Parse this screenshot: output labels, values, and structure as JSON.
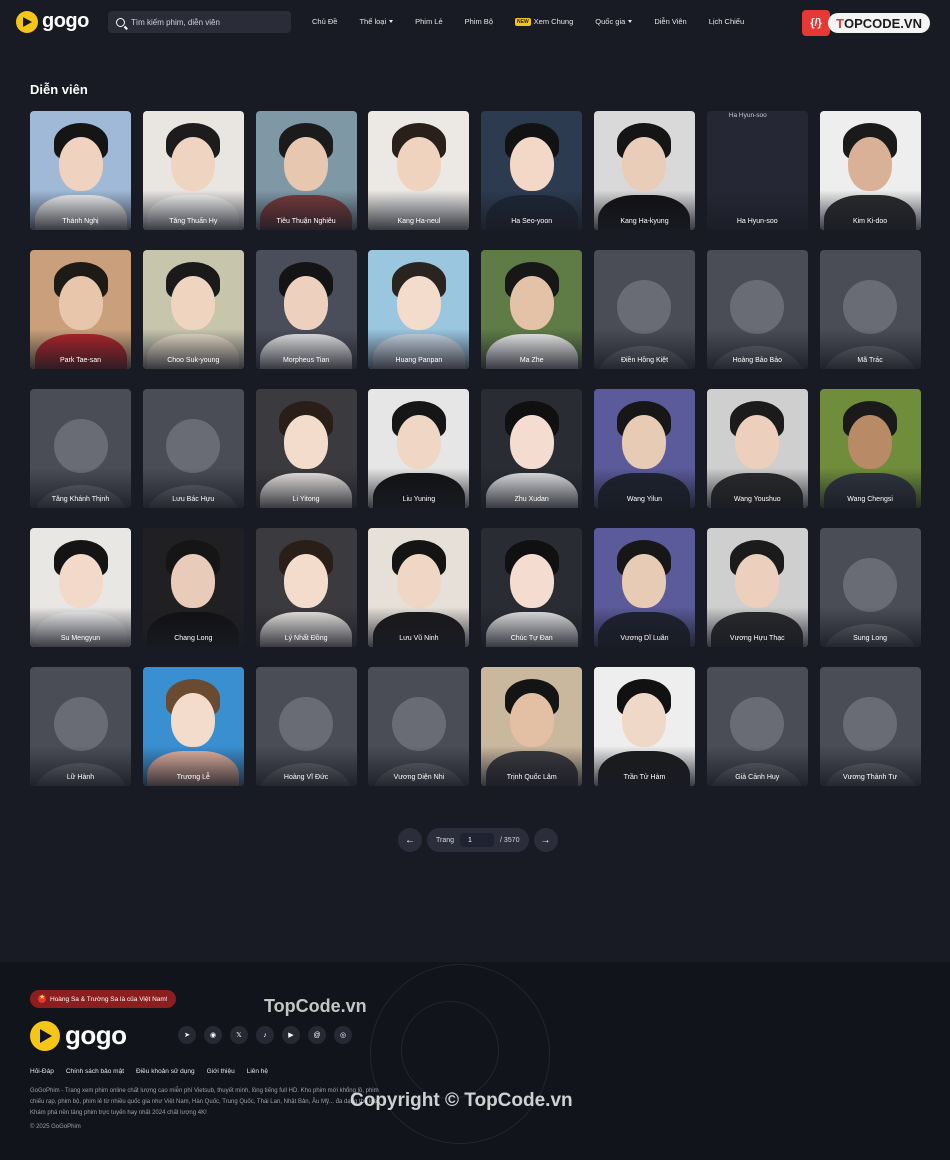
{
  "header": {
    "logo": "gogo",
    "search_placeholder": "Tìm kiếm phim, diễn viên",
    "nav": [
      {
        "label": "Chủ Đề",
        "dropdown": false,
        "badge": ""
      },
      {
        "label": "Thể loại",
        "dropdown": true,
        "badge": ""
      },
      {
        "label": "Phim Lẻ",
        "dropdown": false,
        "badge": ""
      },
      {
        "label": "Phim Bộ",
        "dropdown": false,
        "badge": ""
      },
      {
        "label": "Xem Chung",
        "dropdown": false,
        "badge": "NEW"
      },
      {
        "label": "Quốc gia",
        "dropdown": true,
        "badge": ""
      },
      {
        "label": "Diễn Viên",
        "dropdown": false,
        "badge": ""
      },
      {
        "label": "Lịch Chiếu",
        "dropdown": false,
        "badge": ""
      }
    ],
    "brand_icon": "{/}",
    "brand_text_a": "T",
    "brand_text_b": "OPCODE.VN"
  },
  "page_title": "Diễn viên",
  "actors": [
    {
      "name": "Thành Nghị",
      "kind": "photo",
      "bg": "#9fb9d6",
      "skin": "#efd2bf",
      "hair": "#151515",
      "cloth": "#f2f2f2"
    },
    {
      "name": "Tăng Thuấn Hy",
      "kind": "photo",
      "bg": "#e9e6e2",
      "skin": "#efd4c1",
      "hair": "#1c1c1c",
      "cloth": "#f5f5f5"
    },
    {
      "name": "Tiêu Thuận Nghiêu",
      "kind": "photo",
      "bg": "#7f98a6",
      "skin": "#e8c7b0",
      "hair": "#1b1b1b",
      "cloth": "#7a3b3b"
    },
    {
      "name": "Kang Ha-neul",
      "kind": "photo",
      "bg": "#ece9e4",
      "skin": "#f0d3be",
      "hair": "#2a201a",
      "cloth": "#e7e7e7"
    },
    {
      "name": "Ha Seo-yoon",
      "kind": "photo",
      "bg": "#2c3b50",
      "skin": "#f3d8c8",
      "hair": "#121212",
      "cloth": "#1c2636"
    },
    {
      "name": "Kang Ha-kyung",
      "kind": "photo",
      "bg": "#d9d9d9",
      "skin": "#e9cdb9",
      "hair": "#151515",
      "cloth": "#111111"
    },
    {
      "name": "Ha Hyun-soo",
      "kind": "broken",
      "alt": "Ha Hyun-soo"
    },
    {
      "name": "Kim Ki-doo",
      "kind": "photo",
      "bg": "#eeeeee",
      "skin": "#d9b196",
      "hair": "#1a1a1a",
      "cloth": "#2b2b2b"
    },
    {
      "name": "Park Tae-san",
      "kind": "photo",
      "bg": "#c9a07b",
      "skin": "#e7c6ac",
      "hair": "#1e1a16",
      "cloth": "#b3242a"
    },
    {
      "name": "Choo Suk-young",
      "kind": "photo",
      "bg": "#c8c5ad",
      "skin": "#efd4c0",
      "hair": "#1a1a1a",
      "cloth": "#e6dcc7"
    },
    {
      "name": "Morpheus Tian",
      "kind": "photo",
      "bg": "#4a4e5a",
      "skin": "#edd0bd",
      "hair": "#141414",
      "cloth": "#e7e7e7"
    },
    {
      "name": "Huang Panpan",
      "kind": "photo",
      "bg": "#9ac6e0",
      "skin": "#f3dccc",
      "hair": "#2a2420",
      "cloth": "#c8d6e3"
    },
    {
      "name": "Ma Zhe",
      "kind": "photo",
      "bg": "#5f7b46",
      "skin": "#e3c2a8",
      "hair": "#171717",
      "cloth": "#efefef"
    },
    {
      "name": "Điền Hồng Kiệt",
      "kind": "placeholder"
    },
    {
      "name": "Hoàng Bảo Bảo",
      "kind": "placeholder"
    },
    {
      "name": "Mã Trác",
      "kind": "placeholder"
    },
    {
      "name": "Tăng Khánh Thịnh",
      "kind": "placeholder"
    },
    {
      "name": "Lưu Bác Hựu",
      "kind": "placeholder"
    },
    {
      "name": "Li Yitong",
      "kind": "photo",
      "bg": "#3b3a3e",
      "skin": "#f4dccd",
      "hair": "#2a1e18",
      "cloth": "#f0ece7"
    },
    {
      "name": "Liu Yuning",
      "kind": "photo",
      "bg": "#e6e6e6",
      "skin": "#f0d6c4",
      "hair": "#161616",
      "cloth": "#121212"
    },
    {
      "name": "Zhu Xudan",
      "kind": "photo",
      "bg": "#2a2c34",
      "skin": "#f4ddd0",
      "hair": "#101010",
      "cloth": "#e8e8ea"
    },
    {
      "name": "Wang Yilun",
      "kind": "photo",
      "bg": "#5b5a9a",
      "skin": "#e8cbb5",
      "hair": "#171717",
      "cloth": "#1d2330"
    },
    {
      "name": "Wang Youshuo",
      "kind": "photo",
      "bg": "#cfcfcf",
      "skin": "#ecd0bd",
      "hair": "#1b1b1b",
      "cloth": "#2a2a2a"
    },
    {
      "name": "Wang Chengsi",
      "kind": "photo",
      "bg": "#6f8d3a",
      "skin": "#b98a66",
      "hair": "#1a1a1a",
      "cloth": "#2f3640"
    },
    {
      "name": "Su Mengyun",
      "kind": "photo",
      "bg": "#e9e7e4",
      "skin": "#f2d9c9",
      "hair": "#141414",
      "cloth": "#f2f2f2"
    },
    {
      "name": "Chang Long",
      "kind": "photo",
      "bg": "#202022",
      "skin": "#e8cbb8",
      "hair": "#151515",
      "cloth": "#111111"
    },
    {
      "name": "Lý Nhất Đồng",
      "kind": "photo",
      "bg": "#3b3a3e",
      "skin": "#f4dccd",
      "hair": "#2a1e18",
      "cloth": "#f0ece7"
    },
    {
      "name": "Lưu Vũ Ninh",
      "kind": "photo",
      "bg": "#e6e0d8",
      "skin": "#f0d6c4",
      "hair": "#141414",
      "cloth": "#1a1a1a"
    },
    {
      "name": "Chúc Tự Đan",
      "kind": "photo",
      "bg": "#2a2c34",
      "skin": "#f4ddd0",
      "hair": "#101010",
      "cloth": "#e8e8ea"
    },
    {
      "name": "Vương Dĩ Luân",
      "kind": "photo",
      "bg": "#5b5a9a",
      "skin": "#e8cbb5",
      "hair": "#171717",
      "cloth": "#1d2330"
    },
    {
      "name": "Vương Hựu Thạc",
      "kind": "photo",
      "bg": "#cfcfcf",
      "skin": "#ecd0bd",
      "hair": "#1b1b1b",
      "cloth": "#2a2a2a"
    },
    {
      "name": "Sung Long",
      "kind": "placeholder"
    },
    {
      "name": "Lữ Hành",
      "kind": "placeholder"
    },
    {
      "name": "Trương Lễ",
      "kind": "photo",
      "bg": "#3a8fd0",
      "skin": "#f4dccc",
      "hair": "#6b4a32",
      "cloth": "#e6b4a0"
    },
    {
      "name": "Hoàng Vĩ Đức",
      "kind": "placeholder"
    },
    {
      "name": "Vương Diện Nhi",
      "kind": "placeholder"
    },
    {
      "name": "Trịnh Quốc Lâm",
      "kind": "photo",
      "bg": "#c9b79e",
      "skin": "#e3c0a4",
      "hair": "#141414",
      "cloth": "#3a3a3d"
    },
    {
      "name": "Trần Tử Hàm",
      "kind": "photo",
      "bg": "#eeeeee",
      "skin": "#f0d8c8",
      "hair": "#111111",
      "cloth": "#1b1b1b"
    },
    {
      "name": "Giả Cảnh Huy",
      "kind": "placeholder"
    },
    {
      "name": "Vương Thành Tư",
      "kind": "placeholder"
    }
  ],
  "pagination": {
    "prev_icon": "←",
    "next_icon": "→",
    "label": "Trang",
    "current": "1",
    "total": "/ 3570"
  },
  "footer": {
    "notice": "Hoàng Sa & Trường Sa là của Việt Nam!",
    "logo": "gogo",
    "socials": [
      {
        "icon": "telegram-icon",
        "glyph": "➤"
      },
      {
        "icon": "discord-icon",
        "glyph": "◉"
      },
      {
        "icon": "x-icon",
        "glyph": "𝕏"
      },
      {
        "icon": "tiktok-icon",
        "glyph": "♪"
      },
      {
        "icon": "youtube-icon",
        "glyph": "▶"
      },
      {
        "icon": "threads-icon",
        "glyph": "@"
      },
      {
        "icon": "instagram-icon",
        "glyph": "◎"
      }
    ],
    "links": [
      "Hỏi-Đáp",
      "Chính sách bảo mật",
      "Điều khoản sử dụng",
      "Giới thiệu",
      "Liên hệ"
    ],
    "description": "GoGoPhim - Trang xem phim online chất lượng cao miễn phí Vietsub, thuyết minh, lồng tiếng full HD. Kho phim mới khổng lồ, phim chiếu rạp, phim bộ, phim lẻ từ nhiều quốc gia như Việt Nam, Hàn Quốc, Trung Quốc, Thái Lan, Nhật Bản, Âu Mỹ... đa dạng thể loại. Khám phá nền tảng phim trực tuyến hay nhất 2024 chất lượng 4K!",
    "copyright": "© 2025 GoGoPhim"
  },
  "watermarks": {
    "top": "TopCode.vn",
    "bottom": "Copyright © TopCode.vn"
  },
  "colors": {
    "background": "#191b24",
    "accent": "#f5c518",
    "footer": "#12141b"
  }
}
